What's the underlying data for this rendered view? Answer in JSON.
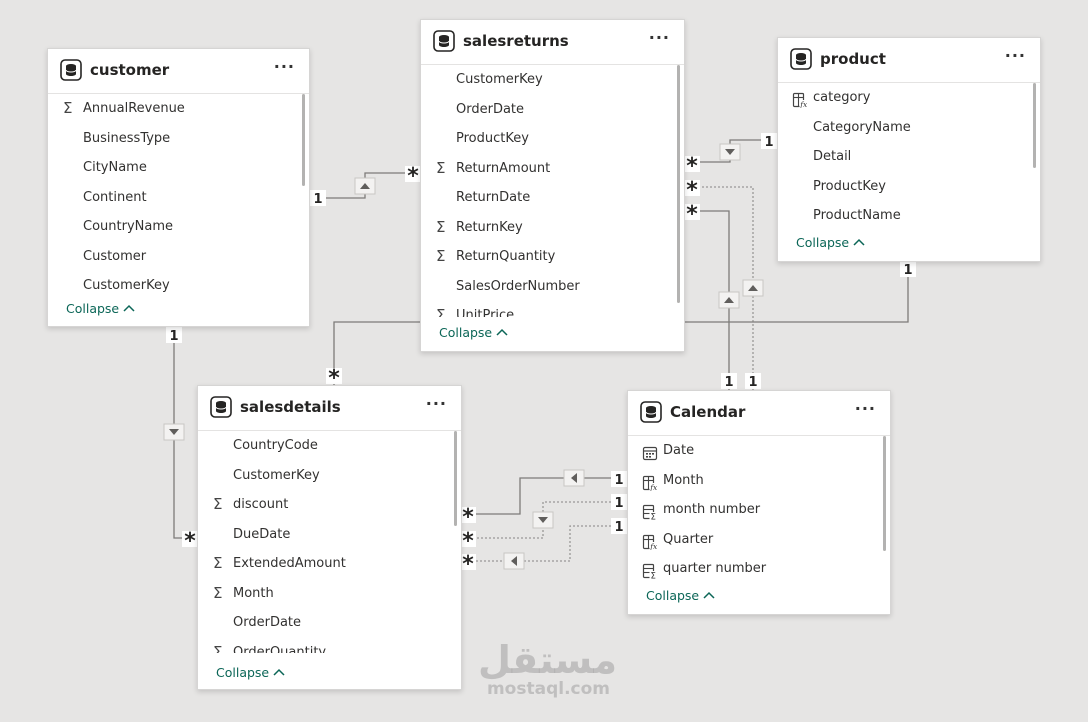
{
  "tables": {
    "customer": {
      "title": "customer",
      "more_label": "···",
      "collapse_label": "Collapse",
      "fields": [
        {
          "label": "AnnualRevenue",
          "icon": "sigma-icon"
        },
        {
          "label": "BusinessType",
          "icon": ""
        },
        {
          "label": "CityName",
          "icon": ""
        },
        {
          "label": "Continent",
          "icon": ""
        },
        {
          "label": "CountryName",
          "icon": ""
        },
        {
          "label": "Customer",
          "icon": ""
        },
        {
          "label": "CustomerKey",
          "icon": ""
        }
      ]
    },
    "salesreturns": {
      "title": "salesreturns",
      "more_label": "···",
      "collapse_label": "Collapse",
      "fields": [
        {
          "label": "CustomerKey",
          "icon": ""
        },
        {
          "label": "OrderDate",
          "icon": ""
        },
        {
          "label": "ProductKey",
          "icon": ""
        },
        {
          "label": "ReturnAmount",
          "icon": "sigma-icon"
        },
        {
          "label": "ReturnDate",
          "icon": ""
        },
        {
          "label": "ReturnKey",
          "icon": "sigma-icon"
        },
        {
          "label": "ReturnQuantity",
          "icon": "sigma-icon"
        },
        {
          "label": "SalesOrderNumber",
          "icon": ""
        },
        {
          "label": "UnitPrice",
          "icon": "sigma-icon"
        }
      ]
    },
    "product": {
      "title": "product",
      "more_label": "···",
      "collapse_label": "Collapse",
      "fields": [
        {
          "label": "category",
          "icon": "calculated-column-icon"
        },
        {
          "label": "CategoryName",
          "icon": ""
        },
        {
          "label": "Detail",
          "icon": ""
        },
        {
          "label": "ProductKey",
          "icon": ""
        },
        {
          "label": "ProductName",
          "icon": ""
        }
      ]
    },
    "salesdetails": {
      "title": "salesdetails",
      "more_label": "···",
      "collapse_label": "Collapse",
      "fields": [
        {
          "label": "CountryCode",
          "icon": ""
        },
        {
          "label": "CustomerKey",
          "icon": ""
        },
        {
          "label": "discount",
          "icon": "sigma-icon"
        },
        {
          "label": "DueDate",
          "icon": ""
        },
        {
          "label": "ExtendedAmount",
          "icon": "sigma-icon"
        },
        {
          "label": "Month",
          "icon": "sigma-icon"
        },
        {
          "label": "OrderDate",
          "icon": ""
        },
        {
          "label": "OrderQuantity",
          "icon": "sigma-icon"
        }
      ]
    },
    "calendar": {
      "title": "Calendar",
      "more_label": "···",
      "collapse_label": "Collapse",
      "fields": [
        {
          "label": "Date",
          "icon": "calendar-icon"
        },
        {
          "label": "Month",
          "icon": "calculated-column-icon"
        },
        {
          "label": "month number",
          "icon": "calculated-measure-icon"
        },
        {
          "label": "Quarter",
          "icon": "calculated-column-icon"
        },
        {
          "label": "quarter number",
          "icon": "calculated-measure-icon"
        }
      ]
    }
  },
  "relationships": {
    "one": "1",
    "many": "*"
  },
  "watermark": {
    "arabic": "مستقل",
    "latin": "mostaql.com"
  },
  "colors": {
    "background": "#e6e5e4",
    "accent": "#0b6657",
    "line": "#8a8886"
  }
}
